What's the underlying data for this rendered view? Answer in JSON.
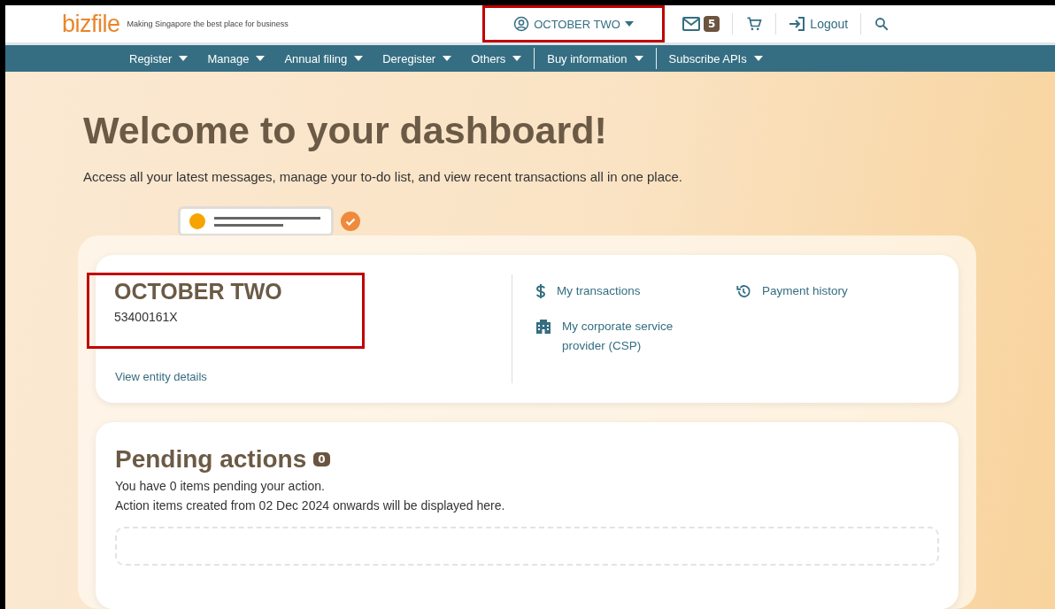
{
  "header": {
    "logo": "bizfile",
    "tagline": "Making Singapore the best place for business",
    "user": "OCTOBER TWO",
    "user_highlighted": true,
    "message_count": "5",
    "logout": "Logout"
  },
  "nav": [
    {
      "label": "Register",
      "divider_before": false
    },
    {
      "label": "Manage",
      "divider_before": false
    },
    {
      "label": "Annual filing",
      "divider_before": false
    },
    {
      "label": "Deregister",
      "divider_before": false
    },
    {
      "label": "Others",
      "divider_before": false
    },
    {
      "label": "Buy information",
      "divider_before": true
    },
    {
      "label": "Subscribe APIs",
      "divider_before": true
    }
  ],
  "welcome": {
    "title": "Welcome to your dashboard!",
    "subtitle": "Access all your latest messages, manage your to-do list, and view recent transactions all in one place."
  },
  "entity": {
    "name": "OCTOBER TWO",
    "uen": "53400161X",
    "highlighted": true,
    "link": "View entity details",
    "links": [
      {
        "kind": "dollar",
        "label": "My transactions"
      },
      {
        "kind": "history",
        "label": "Payment history"
      },
      {
        "kind": "building",
        "label": "My corporate service provider (CSP)"
      }
    ]
  },
  "pending": {
    "title": "Pending actions",
    "count": "0",
    "lines": [
      "You have 0 items pending your action.",
      "Action items created from 02 Dec 2024 onwards will be displayed here."
    ]
  }
}
